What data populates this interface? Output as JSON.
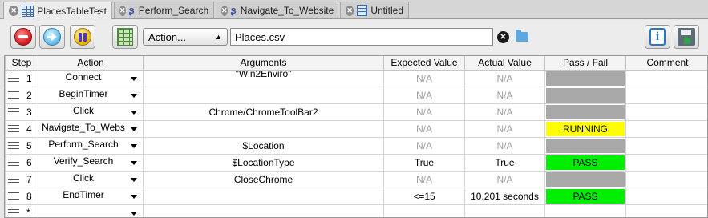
{
  "tabs": [
    {
      "label": "PlacesTableTest",
      "icon": "table-icon",
      "active": true
    },
    {
      "label": "Perform_Search",
      "icon": "script-icon",
      "active": false
    },
    {
      "label": "Navigate_To_Website",
      "icon": "script-icon",
      "active": false
    },
    {
      "label": "Untitled",
      "icon": "table-icon",
      "active": false
    }
  ],
  "toolbar": {
    "action_select": "Action...",
    "file_value": "Places.csv"
  },
  "table": {
    "headers": {
      "step": "Step",
      "action": "Action",
      "arguments": "Arguments",
      "expected": "Expected Value",
      "actual": "Actual Value",
      "passfail": "Pass / Fail",
      "comment": "Comment"
    },
    "rows": [
      {
        "step": "1",
        "action": "Connect",
        "arguments": "\"Win2Enviro\"",
        "expected": "N/A",
        "actual": "N/A",
        "result": "",
        "status": "gray"
      },
      {
        "step": "2",
        "action": "BeginTimer",
        "arguments": "",
        "expected": "N/A",
        "actual": "N/A",
        "result": "",
        "status": "gray"
      },
      {
        "step": "3",
        "action": "Click",
        "arguments": "Chrome/ChromeToolBar2",
        "expected": "N/A",
        "actual": "N/A",
        "result": "",
        "status": "gray"
      },
      {
        "step": "4",
        "action": "Navigate_To_Webs",
        "arguments": "",
        "expected": "N/A",
        "actual": "N/A",
        "result": "RUNNING",
        "status": "yellow"
      },
      {
        "step": "5",
        "action": "Perform_Search",
        "arguments": "$Location",
        "expected": "N/A",
        "actual": "N/A",
        "result": "",
        "status": "gray"
      },
      {
        "step": "6",
        "action": "Verify_Search",
        "arguments": "$LocationType",
        "expected": "True",
        "actual": "True",
        "result": "PASS",
        "status": "green"
      },
      {
        "step": "7",
        "action": "Click",
        "arguments": "CloseChrome",
        "expected": "N/A",
        "actual": "N/A",
        "result": "",
        "status": "gray"
      },
      {
        "step": "8",
        "action": "EndTimer",
        "arguments": "",
        "expected": "<=15",
        "actual": "10.201 seconds",
        "result": "PASS",
        "status": "green"
      },
      {
        "step": "*",
        "action": "",
        "arguments": "",
        "expected": "",
        "actual": "",
        "result": "",
        "status": "none"
      }
    ]
  },
  "colors": {
    "running": "#ffff00",
    "pass": "#00ee00",
    "pending": "#a8a8a8"
  }
}
